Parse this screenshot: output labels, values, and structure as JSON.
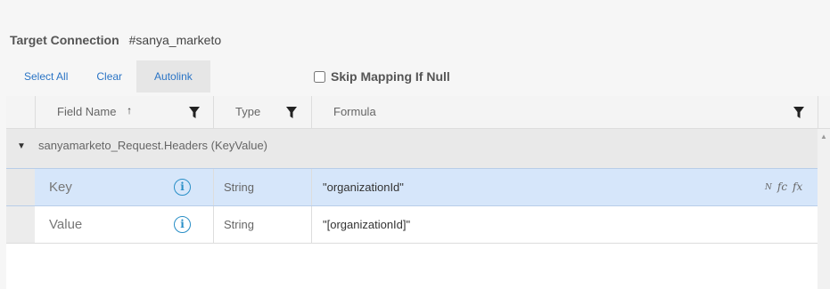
{
  "header": {
    "title": "Target Connection",
    "connection": "#sanya_marketo"
  },
  "toolbar": {
    "select_all": "Select All",
    "clear": "Clear",
    "autolink": "Autolink",
    "skip_label": "Skip Mapping If Null",
    "skip_checked": false
  },
  "columns": {
    "field_name": "Field Name",
    "sort_glyph": "↑",
    "type": "Type",
    "formula": "Formula"
  },
  "group": {
    "label": "sanyamarketo_Request.Headers (KeyValue)",
    "expanded_glyph": "▼"
  },
  "rows": [
    {
      "name": "Key",
      "type": "String",
      "formula": "\"organizationId\"",
      "selected": true
    },
    {
      "name": "Value",
      "type": "String",
      "formula": "\"[organizationId]\"",
      "selected": false
    }
  ],
  "icons": {
    "info": "i",
    "func_n": "N",
    "func_fc": "fc",
    "func_fx": "fx",
    "filter": "filter-icon",
    "scroll_up": "▲"
  }
}
